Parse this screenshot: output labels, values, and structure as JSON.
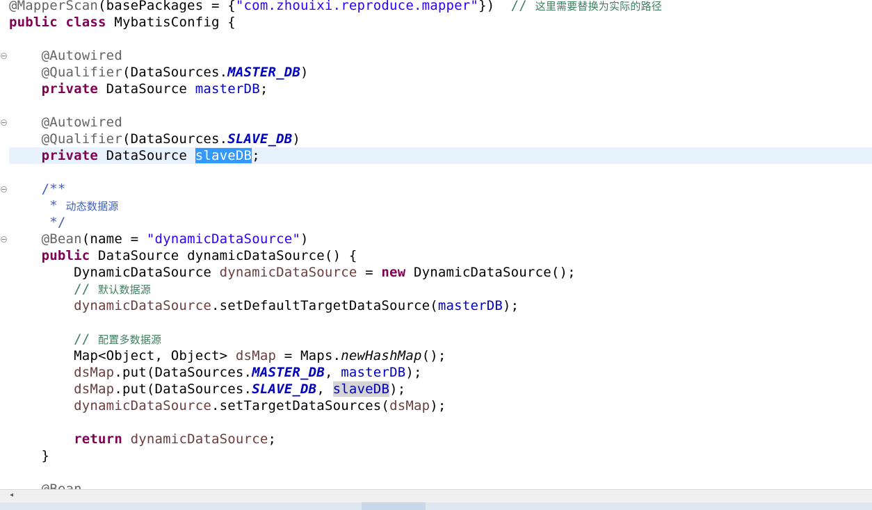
{
  "editor": {
    "lines": [
      {
        "segs": [
          {
            "t": "@MapperScan",
            "c": "ann"
          },
          {
            "t": "(basePackages = {"
          },
          {
            "t": "\"com.zhouixi.reproduce.mapper\"",
            "c": "str"
          },
          {
            "t": "})  "
          },
          {
            "t": "// ",
            "c": "cmt"
          },
          {
            "t": "这里需要替换为实际的路径",
            "c": "cmt cjk"
          }
        ]
      },
      {
        "segs": [
          {
            "t": "public",
            "c": "kw"
          },
          {
            "t": " "
          },
          {
            "t": "class",
            "c": "kw"
          },
          {
            "t": " MybatisConfig {"
          }
        ]
      },
      {
        "segs": []
      },
      {
        "segs": [
          {
            "t": "    "
          },
          {
            "t": "@Autowired",
            "c": "ann"
          }
        ]
      },
      {
        "segs": [
          {
            "t": "    "
          },
          {
            "t": "@Qualifier",
            "c": "ann"
          },
          {
            "t": "(DataSources."
          },
          {
            "t": "MASTER_DB",
            "c": "cst"
          },
          {
            "t": ")"
          }
        ]
      },
      {
        "segs": [
          {
            "t": "    "
          },
          {
            "t": "private",
            "c": "kw"
          },
          {
            "t": " DataSource "
          },
          {
            "t": "masterDB",
            "c": "fld"
          },
          {
            "t": ";"
          }
        ]
      },
      {
        "segs": []
      },
      {
        "segs": [
          {
            "t": "    "
          },
          {
            "t": "@Autowired",
            "c": "ann"
          }
        ]
      },
      {
        "segs": [
          {
            "t": "    "
          },
          {
            "t": "@Qualifier",
            "c": "ann"
          },
          {
            "t": "(DataSources."
          },
          {
            "t": "SLAVE_DB",
            "c": "cst"
          },
          {
            "t": ")"
          }
        ]
      },
      {
        "segs": [
          {
            "t": "    "
          },
          {
            "t": "private",
            "c": "kw"
          },
          {
            "t": " DataSource "
          },
          {
            "t": "slaveDB",
            "c": "sel"
          },
          {
            "t": ";"
          }
        ]
      },
      {
        "segs": []
      },
      {
        "segs": [
          {
            "t": "    "
          },
          {
            "t": "/**",
            "c": "jdoc"
          }
        ]
      },
      {
        "segs": [
          {
            "t": "     * ",
            "c": "jdoc"
          },
          {
            "t": "动态数据源",
            "c": "jdoc cjk"
          }
        ]
      },
      {
        "segs": [
          {
            "t": "     */",
            "c": "jdoc"
          }
        ]
      },
      {
        "segs": [
          {
            "t": "    "
          },
          {
            "t": "@Bean",
            "c": "ann"
          },
          {
            "t": "(name = "
          },
          {
            "t": "\"dynamicDataSource\"",
            "c": "str"
          },
          {
            "t": ")"
          }
        ]
      },
      {
        "segs": [
          {
            "t": "    "
          },
          {
            "t": "public",
            "c": "kw"
          },
          {
            "t": " DataSource dynamicDataSource() {"
          }
        ]
      },
      {
        "segs": [
          {
            "t": "        DynamicDataSource "
          },
          {
            "t": "dynamicDataSource",
            "c": "loc"
          },
          {
            "t": " = "
          },
          {
            "t": "new",
            "c": "kw"
          },
          {
            "t": " DynamicDataSource();"
          }
        ]
      },
      {
        "segs": [
          {
            "t": "        "
          },
          {
            "t": "// ",
            "c": "cmt"
          },
          {
            "t": "默认数据源",
            "c": "cmt cjk"
          }
        ]
      },
      {
        "segs": [
          {
            "t": "        "
          },
          {
            "t": "dynamicDataSource",
            "c": "loc"
          },
          {
            "t": ".setDefaultTargetDataSource("
          },
          {
            "t": "masterDB",
            "c": "fld"
          },
          {
            "t": ");"
          }
        ]
      },
      {
        "segs": []
      },
      {
        "segs": [
          {
            "t": "        "
          },
          {
            "t": "// ",
            "c": "cmt"
          },
          {
            "t": "配置多数据源",
            "c": "cmt cjk"
          }
        ]
      },
      {
        "segs": [
          {
            "t": "        Map<Object, Object> "
          },
          {
            "t": "dsMap",
            "c": "loc"
          },
          {
            "t": " = Maps."
          },
          {
            "t": "newHashMap",
            "c": "stat"
          },
          {
            "t": "();"
          }
        ]
      },
      {
        "segs": [
          {
            "t": "        "
          },
          {
            "t": "dsMap",
            "c": "loc"
          },
          {
            "t": ".put(DataSources."
          },
          {
            "t": "MASTER_DB",
            "c": "cst"
          },
          {
            "t": ", "
          },
          {
            "t": "masterDB",
            "c": "fld"
          },
          {
            "t": ");"
          }
        ]
      },
      {
        "segs": [
          {
            "t": "        "
          },
          {
            "t": "dsMap",
            "c": "loc"
          },
          {
            "t": ".put(DataSources."
          },
          {
            "t": "SLAVE_DB",
            "c": "cst"
          },
          {
            "t": ", "
          },
          {
            "t": "slaveDB",
            "c": "fld occ"
          },
          {
            "t": ");"
          }
        ]
      },
      {
        "segs": [
          {
            "t": "        "
          },
          {
            "t": "dynamicDataSource",
            "c": "loc"
          },
          {
            "t": ".setTargetDataSources("
          },
          {
            "t": "dsMap",
            "c": "loc"
          },
          {
            "t": ");"
          }
        ]
      },
      {
        "segs": []
      },
      {
        "segs": [
          {
            "t": "        "
          },
          {
            "t": "return",
            "c": "kw"
          },
          {
            "t": " "
          },
          {
            "t": "dynamicDataSource",
            "c": "loc"
          },
          {
            "t": ";"
          }
        ]
      },
      {
        "segs": [
          {
            "t": "    }"
          }
        ]
      },
      {
        "segs": []
      },
      {
        "segs": [
          {
            "t": "    "
          },
          {
            "t": "@Bean",
            "c": "ann"
          }
        ]
      }
    ],
    "fold_lines": [
      3,
      7,
      11,
      14
    ]
  },
  "scrollbar": {
    "left_arrow_icon": "chevron-left-icon",
    "left_arrow_glyph": "◂"
  },
  "colors": {
    "keyword": "#7f0055",
    "annotation": "#646464",
    "string": "#2a00ff",
    "constant": "#0000c0",
    "field": "#0000c0",
    "local": "#6a3e3e",
    "comment": "#3f7f5f",
    "javadoc": "#3f5fbf",
    "selection": "#3399ff",
    "current_line": "#e8f2fe"
  }
}
